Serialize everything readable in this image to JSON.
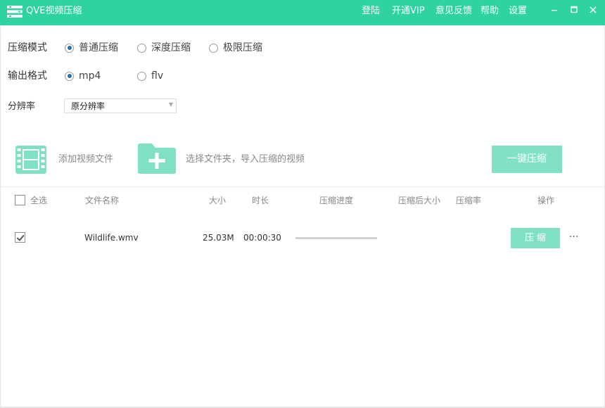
{
  "titlebar": {
    "app_title": "QVE视频压缩",
    "nav": [
      "登陆",
      "开通VIP",
      "意见反馈",
      "帮助",
      "设置"
    ],
    "logo_icon": "film-strip-logo-icon",
    "controls": [
      "minimize-icon",
      "maximize-icon",
      "close-icon"
    ],
    "bg_color": "#2fd3a2"
  },
  "options": {
    "compress_mode": {
      "label": "压缩模式",
      "choices": [
        "普通压缩",
        "深度压缩",
        "极限压缩"
      ],
      "selected": "普通压缩"
    },
    "output_format": {
      "label": "输出格式",
      "choices": [
        "mp4",
        "flv"
      ],
      "selected": "mp4"
    },
    "resolution": {
      "label": "分辨率",
      "value": "原分辨率"
    }
  },
  "actions": {
    "add_video": "添加视频文件",
    "choose_folder": "选择文件夹，导入压缩的视频",
    "one_key_compress": "一键压缩",
    "add_video_icon": "film-icon",
    "folder_icon": "folder-plus-icon"
  },
  "table": {
    "select_all": "全选",
    "columns": [
      "文件名称",
      "大小",
      "时长",
      "压缩进度",
      "压缩后大小",
      "压缩率",
      "操作"
    ],
    "rows": [
      {
        "checked": true,
        "file_name": "Wildlife.wmv",
        "size": "25.03M",
        "duration": "00:00:30",
        "progress": 0,
        "compressed_size": "",
        "ratio": "",
        "action_label": "压缩",
        "more": "···"
      }
    ]
  },
  "colors": {
    "accent": "#2fd3a2",
    "button_light": "#80e1c4",
    "radio_selected": "#2a6fb5"
  }
}
